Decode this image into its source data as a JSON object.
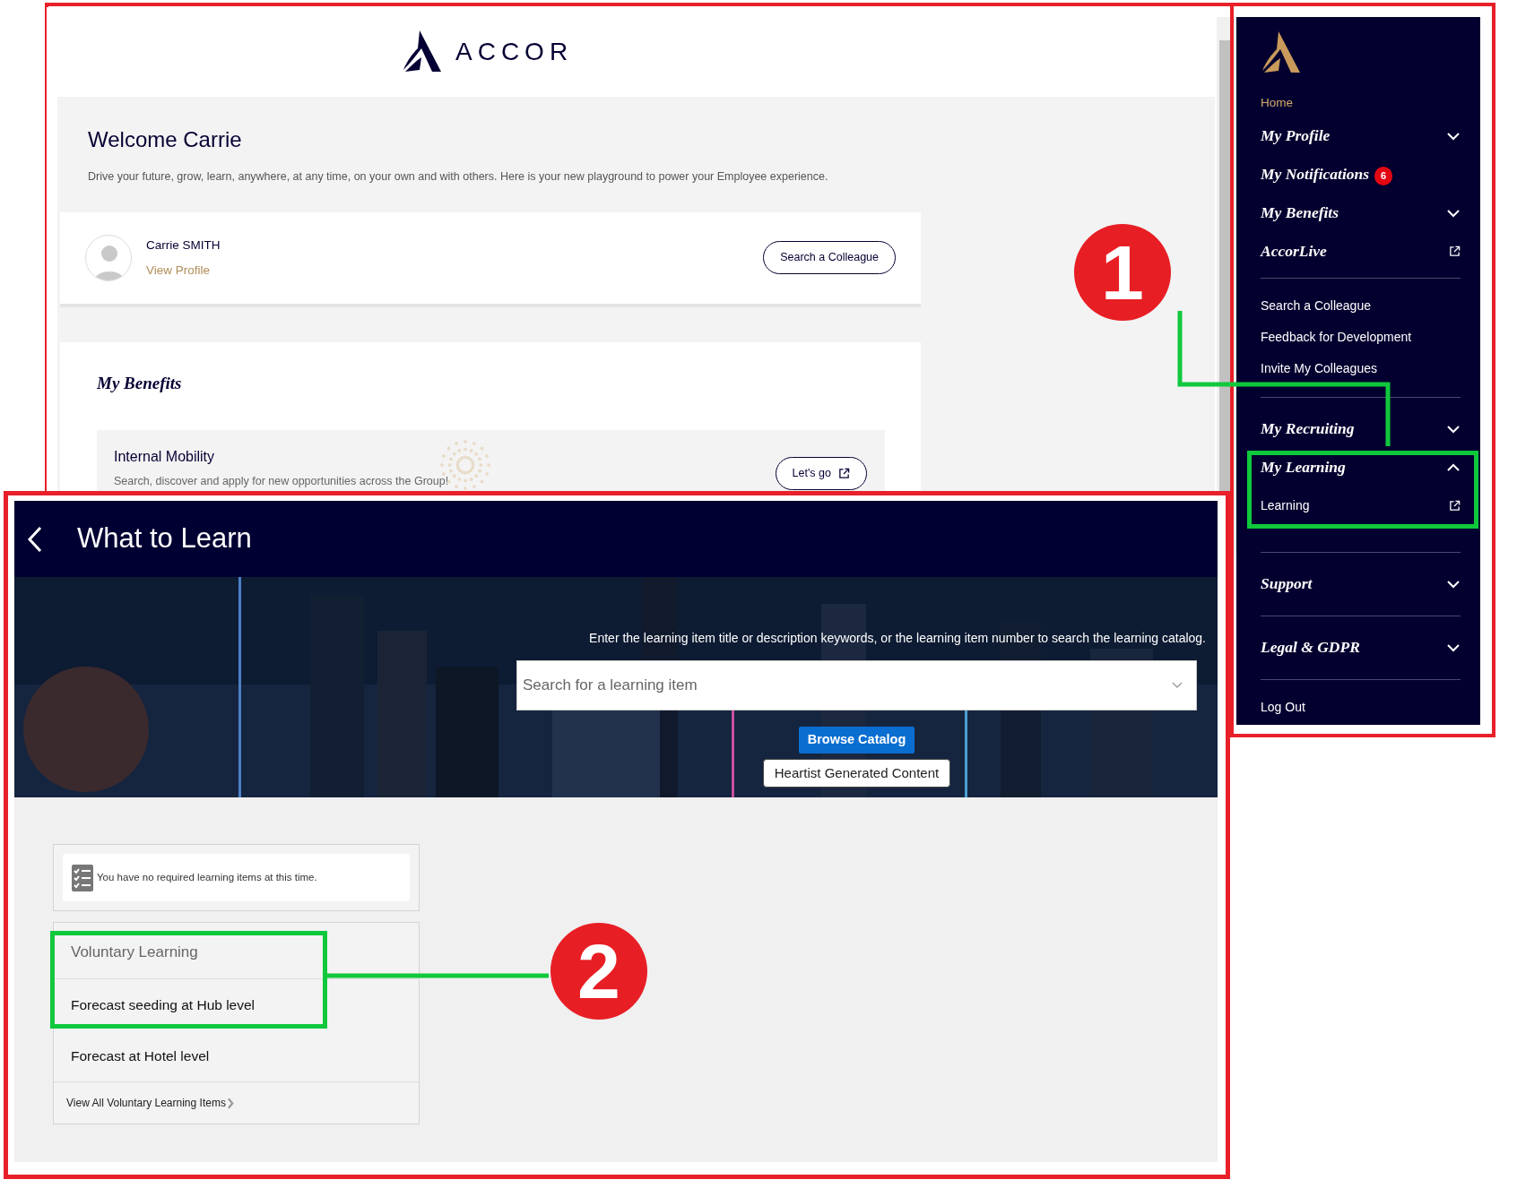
{
  "portal": {
    "logo_text": "ACCOR",
    "welcome": {
      "title": "Welcome Carrie",
      "text": "Drive your future, grow, learn, anywhere, at any time, on your own and with others. Here is your new playground to power your Employee experience."
    },
    "profile": {
      "name": "Carrie SMITH",
      "link": "View Profile",
      "button": "Search a Colleague"
    },
    "benefits": {
      "title": "My Benefits",
      "items": [
        {
          "title": "Internal Mobility",
          "text": "Search, discover and apply for new opportunities across the Group!",
          "button": "Let's go"
        }
      ]
    }
  },
  "sidebar": {
    "groups": [
      {
        "items": [
          {
            "label": "Home",
            "kind": "home"
          },
          {
            "label": "My Profile",
            "kind": "section",
            "expanded": false
          },
          {
            "label": "My Notifications",
            "kind": "section",
            "badge": "6"
          },
          {
            "label": "My Benefits",
            "kind": "section",
            "expanded": false
          },
          {
            "label": "AccorLive",
            "kind": "section",
            "external": true
          }
        ]
      },
      {
        "items": [
          {
            "label": "Search a Colleague",
            "kind": "link"
          },
          {
            "label": "Feedback for Development",
            "kind": "link"
          },
          {
            "label": "Invite My Colleagues",
            "kind": "link"
          }
        ]
      },
      {
        "items": [
          {
            "label": "My Recruiting",
            "kind": "section",
            "expanded": false
          },
          {
            "label": "My Learning",
            "kind": "section",
            "expanded": true,
            "children": [
              {
                "label": "Learning",
                "kind": "link",
                "external": true
              }
            ]
          }
        ]
      },
      {
        "items": [
          {
            "label": "Support",
            "kind": "section",
            "expanded": false
          }
        ]
      },
      {
        "items": [
          {
            "label": "Legal & GDPR",
            "kind": "section",
            "expanded": false
          }
        ]
      },
      {
        "items": [
          {
            "label": "Log Out",
            "kind": "link"
          }
        ]
      }
    ]
  },
  "learning": {
    "title": "What to Learn",
    "banner": {
      "kind": "picture",
      "hint": "Enter the learning item title or description keywords, or the learning item number to search the learning catalog.",
      "search_placeholder": "Search for a learning item",
      "browse_button": "Browse Catalog",
      "tooltip": "Heartist Generated Content"
    },
    "required": {
      "message": "You have no required learning items at this time."
    },
    "voluntary": {
      "title": "Voluntary Learning",
      "items": [
        "Forecast seeding at Hub level",
        "Forecast at Hotel level"
      ],
      "view_all": "View All Voluntary Learning Items"
    }
  },
  "annotations": [
    {
      "label": "1"
    },
    {
      "label": "2"
    }
  ]
}
